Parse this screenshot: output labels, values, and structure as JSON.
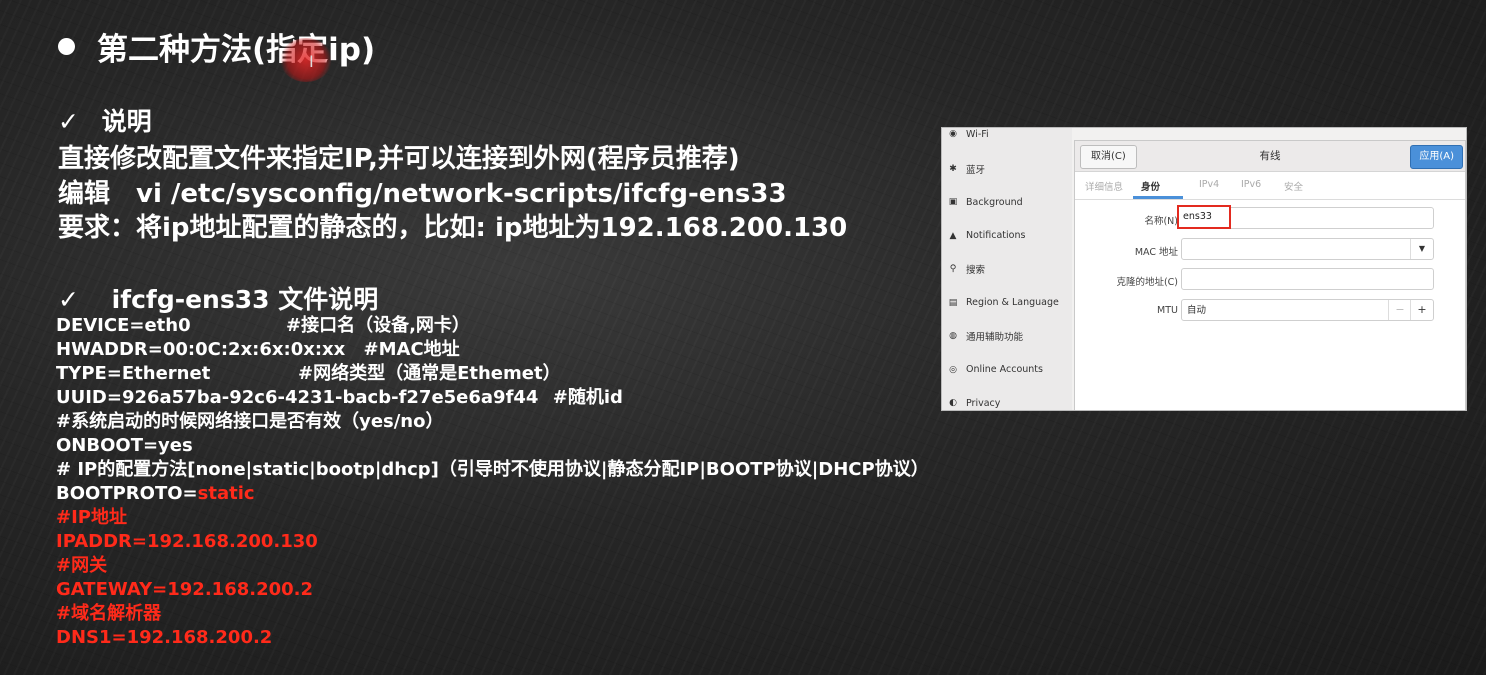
{
  "slide": {
    "title": "第二种方法(指定ip)",
    "section1": {
      "check": "✓",
      "heading": "说明",
      "lines": [
        "直接修改配置文件来指定IP,并可以连接到外网(程序员推荐)",
        "编辑　vi /etc/sysconfig/network-scripts/ifcfg-ens33",
        "要求：将ip地址配置的静态的，比如: ip地址为192.168.200.130"
      ]
    },
    "section2": {
      "check": "✓",
      "heading": "ifcfg-ens33 文件说明"
    },
    "code": {
      "device": "DEVICE=eth0",
      "device_comment": "#接口名（设备,网卡）",
      "hwaddr": "HWADDR=00:0C:2x:6x:0x:xx",
      "hwaddr_comment": "#MAC地址",
      "type": "TYPE=Ethernet",
      "type_comment": "#网络类型（通常是Ethemet）",
      "uuid": "UUID=926a57ba-92c6-4231-bacb-f27e5e6a9f44",
      "uuid_comment": "#随机id",
      "onboot_comment": "#系统启动的时候网络接口是否有效（yes/no）",
      "onboot": "ONBOOT=yes",
      "proto_comment": "# IP的配置方法[none|static|bootp|dhcp]（引导时不使用协议|静态分配IP|BOOTP协议|DHCP协议）",
      "bootproto_key": "BOOTPROTO=",
      "bootproto_val": "static",
      "ip_comment": "#IP地址",
      "ipaddr": "IPADDR=192.168.200.130",
      "gw_comment": "#网关",
      "gateway": "GATEWAY=192.168.200.2",
      "dns_comment": "#域名解析器",
      "dns": "DNS1=192.168.200.2"
    }
  },
  "settings": {
    "sidebar": [
      {
        "icon": "wifi-icon",
        "glyph": "◉",
        "label": "Wi-Fi"
      },
      {
        "icon": "bluetooth-icon",
        "glyph": "✱",
        "label": "蓝牙"
      },
      {
        "icon": "background-icon",
        "glyph": "▣",
        "label": "Background"
      },
      {
        "icon": "notifications-icon",
        "glyph": "▲",
        "label": "Notifications"
      },
      {
        "icon": "search-icon",
        "glyph": "⚲",
        "label": "搜索"
      },
      {
        "icon": "region-icon",
        "glyph": "▤",
        "label": "Region & Language"
      },
      {
        "icon": "accessibility-icon",
        "glyph": "◍",
        "label": "通用辅助功能"
      },
      {
        "icon": "online-accounts-icon",
        "glyph": "◎",
        "label": "Online Accounts"
      },
      {
        "icon": "privacy-icon",
        "glyph": "◐",
        "label": "Privacy"
      }
    ],
    "dialog": {
      "cancel": "取消(C)",
      "title": "有线",
      "apply": "应用(A)",
      "tabs": [
        "详细信息",
        "身份",
        "IPv4",
        "IPv6",
        "安全"
      ],
      "active_tab": 1,
      "name_label": "名称(N)",
      "name_value": "ens33",
      "mac_label": "MAC 地址",
      "clone_label": "克隆的地址(C)",
      "mtu_label": "MTU",
      "mtu_value": "自动",
      "minus": "−",
      "plus": "+",
      "dropdown": "▼"
    }
  }
}
